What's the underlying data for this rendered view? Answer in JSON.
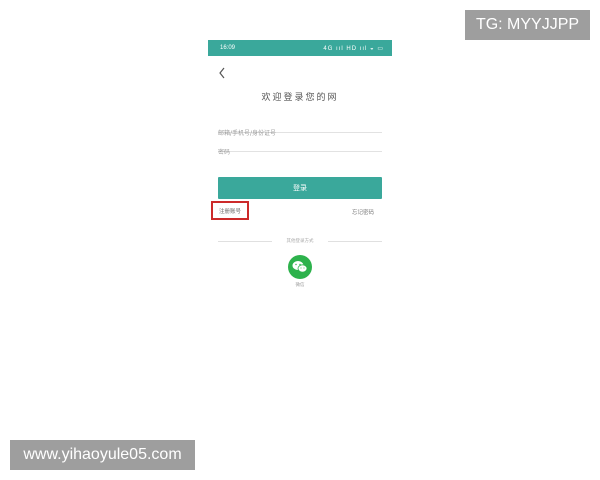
{
  "overlay": {
    "tg_text": "TG: MYYJJPP",
    "url_text": "www.yihaoyule05.com"
  },
  "status_bar": {
    "time": "16:09",
    "icons_text": "4G ııl HD ııl ◒ ▭",
    "color": "#3aa89b"
  },
  "nav": {
    "back_icon": "chevron-left-icon"
  },
  "login": {
    "title": "欢迎登录您的网",
    "account_placeholder": "邮箱/手机号/身份证号",
    "password_placeholder": "密码",
    "login_label": "登录",
    "register_label": "注册账号",
    "forgot_label": "忘记密码",
    "other_methods_label": "其他登录方式",
    "wechat_label": "微信",
    "accent_color": "#3aa89b",
    "highlight_color": "#cc2a2a",
    "wechat_color": "#2db24c"
  }
}
